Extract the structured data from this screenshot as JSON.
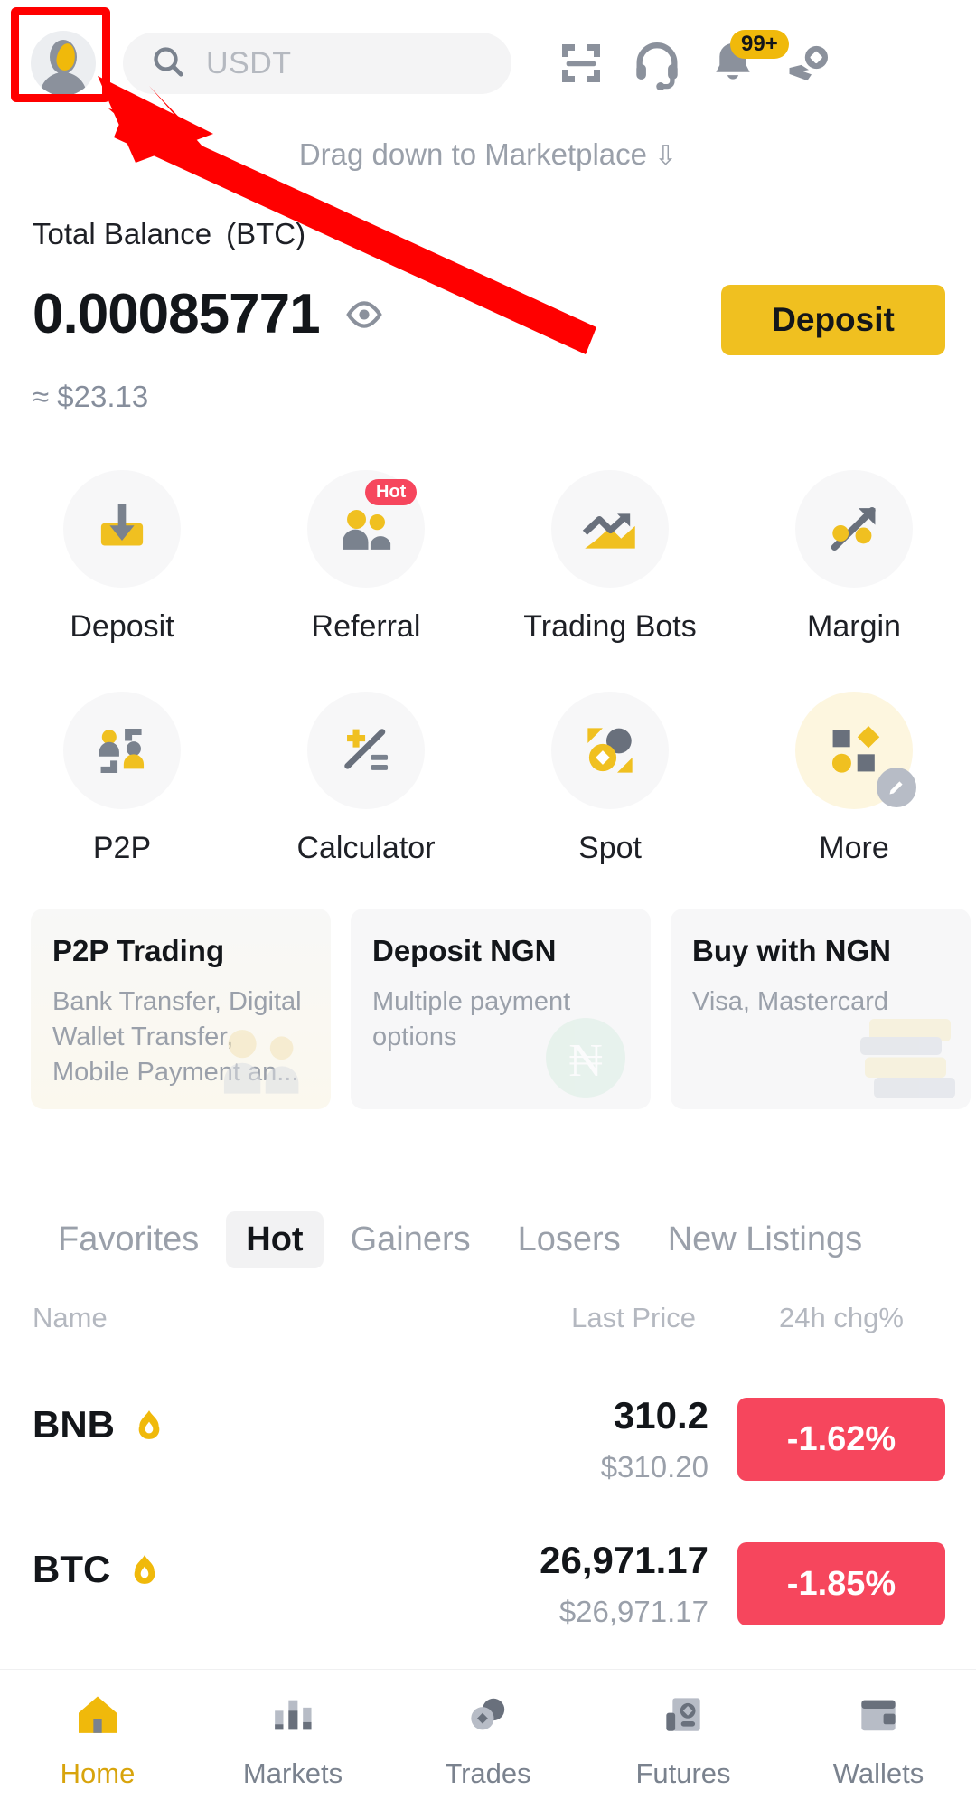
{
  "header": {
    "avatar_alt": "User avatar",
    "search_placeholder": "USDT",
    "icons": {
      "scan": "scan-icon",
      "support": "headset-icon",
      "notifications": "bell-icon",
      "notification_badge": "99+",
      "earn": "hand-coin-icon"
    }
  },
  "drag_hint": {
    "text": "Drag down to Marketplace"
  },
  "balance": {
    "label": "Total Balance",
    "currency": "(BTC)",
    "value": "0.00085771",
    "approx": "≈ $23.13",
    "deposit_label": "Deposit"
  },
  "quick_actions": [
    {
      "label": "Deposit",
      "icon": "deposit-tray-icon",
      "badge": null
    },
    {
      "label": "Referral",
      "icon": "referral-people-icon",
      "badge": "Hot"
    },
    {
      "label": "Trading Bots",
      "icon": "chart-arrow-icon",
      "badge": null
    },
    {
      "label": "Margin",
      "icon": "margin-arrow-icon",
      "badge": null
    },
    {
      "label": "P2P",
      "icon": "p2p-people-icon",
      "badge": null
    },
    {
      "label": "Calculator",
      "icon": "calculator-icon",
      "badge": null
    },
    {
      "label": "Spot",
      "icon": "spot-coin-icon",
      "badge": null
    },
    {
      "label": "More",
      "icon": "more-shapes-icon",
      "badge": null
    }
  ],
  "promos": [
    {
      "title": "P2P Trading",
      "subtitle": "Bank Transfer, Digital Wallet Transfer, Mobile Payment an..."
    },
    {
      "title": "Deposit NGN",
      "subtitle": "Multiple payment options"
    },
    {
      "title": "Buy with NGN",
      "subtitle": "Visa, Mastercard"
    }
  ],
  "market": {
    "tabs": [
      {
        "label": "Favorites",
        "active": false
      },
      {
        "label": "Hot",
        "active": true
      },
      {
        "label": "Gainers",
        "active": false
      },
      {
        "label": "Losers",
        "active": false
      },
      {
        "label": "New Listings",
        "active": false
      }
    ],
    "columns": {
      "name": "Name",
      "price": "Last Price",
      "change": "24h chg%"
    },
    "rows": [
      {
        "symbol": "BNB",
        "hot": true,
        "price": "310.2",
        "usd": "$310.20",
        "change": "-1.62%",
        "change_color": "#f6465d"
      },
      {
        "symbol": "BTC",
        "hot": true,
        "price": "26,971.17",
        "usd": "$26,971.17",
        "change": "-1.85%",
        "change_color": "#f6465d"
      }
    ]
  },
  "bottom_nav": [
    {
      "label": "Home",
      "icon": "home-icon",
      "active": true
    },
    {
      "label": "Markets",
      "icon": "bars-icon",
      "active": false
    },
    {
      "label": "Trades",
      "icon": "coins-icon",
      "active": false
    },
    {
      "label": "Futures",
      "icon": "futures-icon",
      "active": false
    },
    {
      "label": "Wallets",
      "icon": "wallet-icon",
      "active": false
    }
  ],
  "theme": {
    "accent": "#f0b90b",
    "deposit_button": "#f0c020",
    "down_red": "#f6465d",
    "text_primary": "#13161a",
    "text_muted": "#9aa0aa",
    "annotation": "#ff0000"
  }
}
